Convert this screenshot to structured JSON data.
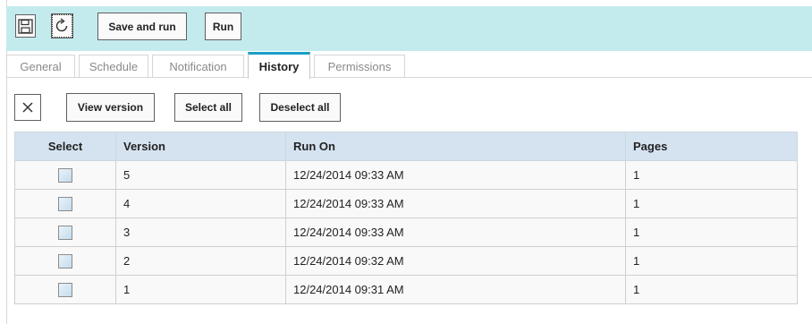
{
  "toolbar": {
    "save_and_run_label": "Save and run",
    "run_label": "Run",
    "save_icon": "floppy-disk-icon",
    "refresh_icon": "refresh-icon",
    "background_color": "#c3ebee"
  },
  "tabs": [
    {
      "label": "General"
    },
    {
      "label": "Schedule"
    },
    {
      "label": "Notification"
    },
    {
      "label": "History",
      "active": true
    },
    {
      "label": "Permissions"
    }
  ],
  "history_actions": {
    "delete_icon": "close-icon",
    "view_version_label": "View version",
    "select_all_label": "Select all",
    "deselect_all_label": "Deselect all"
  },
  "table": {
    "columns": [
      "Select",
      "Version",
      "Run On",
      "Pages"
    ],
    "rows": [
      {
        "selected": false,
        "version": "5",
        "run_on": "12/24/2014 09:33 AM",
        "pages": "1"
      },
      {
        "selected": false,
        "version": "4",
        "run_on": "12/24/2014 09:33 AM",
        "pages": "1"
      },
      {
        "selected": false,
        "version": "3",
        "run_on": "12/24/2014 09:33 AM",
        "pages": "1"
      },
      {
        "selected": false,
        "version": "2",
        "run_on": "12/24/2014 09:32 AM",
        "pages": "1"
      },
      {
        "selected": false,
        "version": "1",
        "run_on": "12/24/2014 09:31 AM",
        "pages": "1"
      }
    ],
    "header_color": "#d5e3f1"
  },
  "accent_color": "#1a9ec8"
}
